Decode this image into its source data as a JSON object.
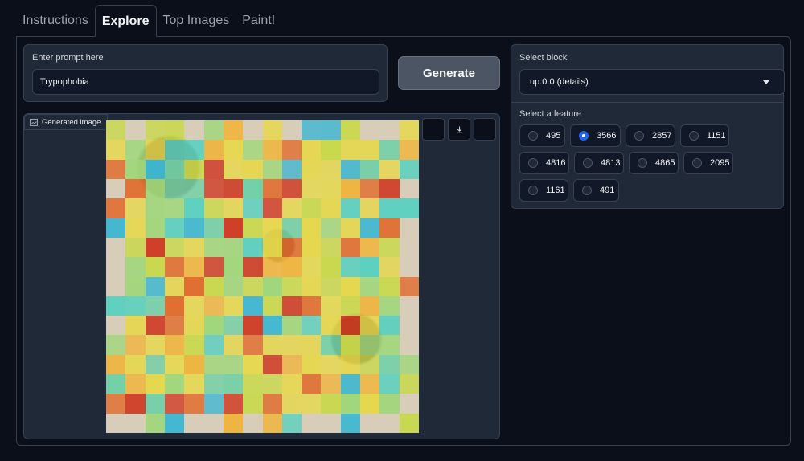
{
  "tabs": [
    {
      "label": "Instructions",
      "active": false
    },
    {
      "label": "Explore",
      "active": true
    },
    {
      "label": "Top Images",
      "active": false
    },
    {
      "label": "Paint!",
      "active": false
    }
  ],
  "prompt": {
    "label": "Enter prompt here",
    "value": "Trypophobia"
  },
  "generate_button": {
    "label": "Generate"
  },
  "image_panel": {
    "label": "Generated image",
    "buttons": [
      "blank-button",
      "download-icon",
      "blank-button"
    ]
  },
  "block_select": {
    "label": "Select block",
    "value": "up.0.0 (details)"
  },
  "feature_select": {
    "label": "Select a feature",
    "options": [
      "495",
      "3566",
      "2857",
      "1151",
      "4816",
      "4813",
      "4865",
      "2095",
      "1161",
      "491"
    ],
    "selected": "3566"
  },
  "colors": {
    "background": "#0b0f19",
    "panel": "#1f2937",
    "border": "#374151",
    "accent": "#2563eb"
  }
}
